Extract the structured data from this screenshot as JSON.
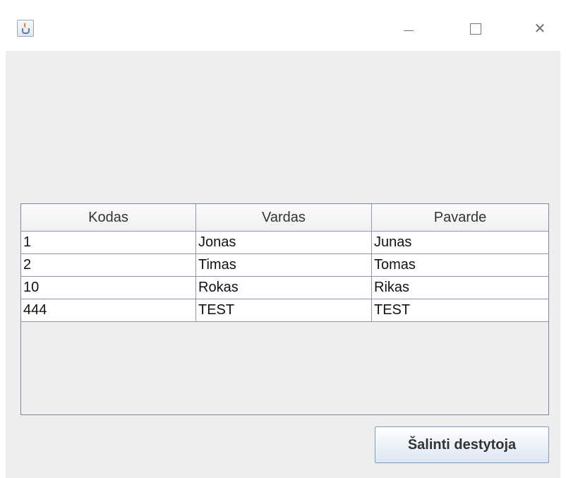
{
  "window": {
    "controls": {
      "minimize": "",
      "maximize": "",
      "close": "✕"
    },
    "icon": "java-cup-icon"
  },
  "table": {
    "columns": [
      "Kodas",
      "Vardas",
      "Pavarde"
    ],
    "rows": [
      [
        "1",
        "Jonas",
        "Junas"
      ],
      [
        "2",
        "Timas",
        "Tomas"
      ],
      [
        "10",
        "Rokas",
        "Rikas"
      ],
      [
        "444",
        "TEST",
        "TEST"
      ]
    ]
  },
  "actions": {
    "delete_label": "Šalinti destytoja"
  },
  "colors": {
    "content_background": "#eeeeee",
    "grid": "#8d99a8",
    "button_border": "#7f9db9"
  }
}
